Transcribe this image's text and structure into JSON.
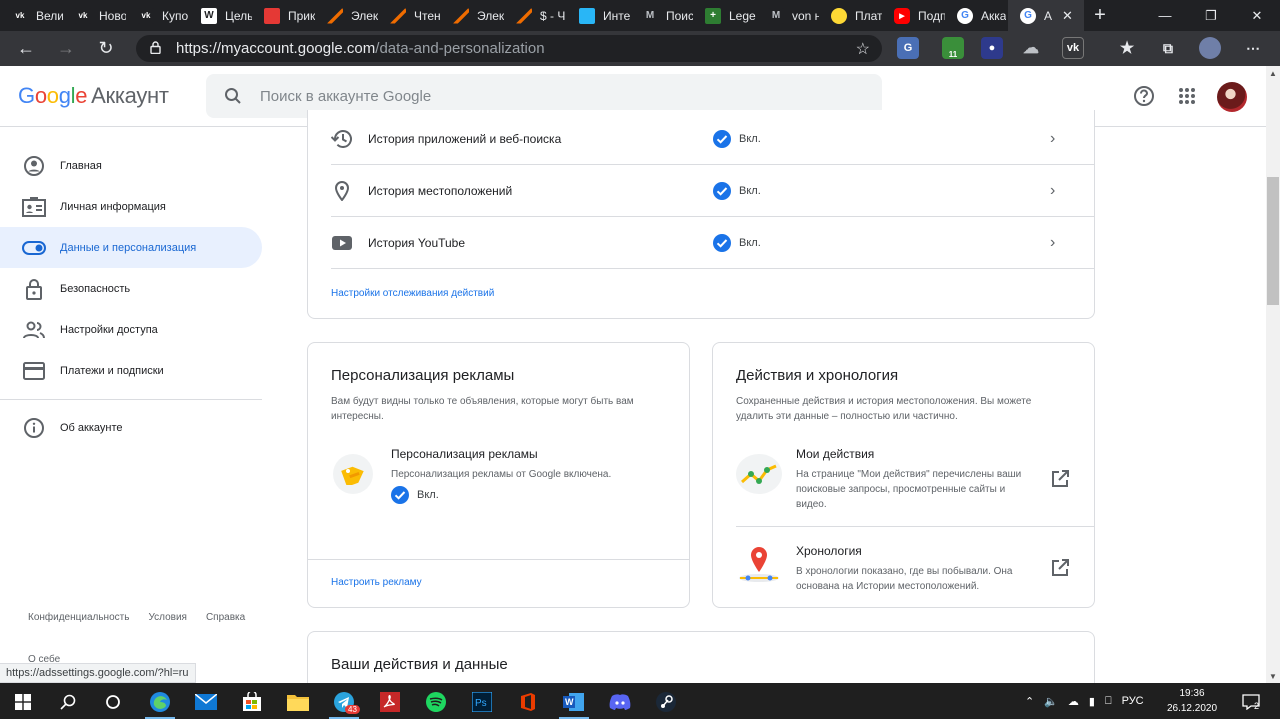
{
  "browser": {
    "tabs": [
      {
        "title": "Вели",
        "favicon": "vk-icon",
        "color": "#202124"
      },
      {
        "title": "Ново",
        "favicon": "vk-icon",
        "color": "#202124"
      },
      {
        "title": "Купо",
        "favicon": "vk-icon",
        "color": "#202124"
      },
      {
        "title": "Цель",
        "favicon": "wiki-icon",
        "color": "#ffffff"
      },
      {
        "title": "Прик",
        "favicon": "video-icon",
        "color": "#e53935"
      },
      {
        "title": "Элек",
        "favicon": "pen-icon",
        "color": "#ef6c00"
      },
      {
        "title": "Чтен",
        "favicon": "pen-icon",
        "color": "#ef6c00"
      },
      {
        "title": "Элек",
        "favicon": "pen-icon",
        "color": "#ef6c00"
      },
      {
        "title": "$ - Ч",
        "favicon": "pen-icon",
        "color": "#ef6c00"
      },
      {
        "title": "Инте",
        "favicon": "square-icon",
        "color": "#29b6f6"
      },
      {
        "title": "Поис",
        "favicon": "m-icon",
        "color": "#202124"
      },
      {
        "title": "Leger",
        "favicon": "plus-icon",
        "color": "#2e7d32"
      },
      {
        "title": "von н",
        "favicon": "m-icon",
        "color": "#202124"
      },
      {
        "title": "Плате",
        "favicon": "coin-icon",
        "color": "#fdd835"
      },
      {
        "title": "Подп",
        "favicon": "youtube-icon",
        "color": "#ff0000"
      },
      {
        "title": "Акка",
        "favicon": "google-icon",
        "color": "#ffffff"
      },
      {
        "title": "А",
        "favicon": "google-icon",
        "color": "#ffffff",
        "active": true
      }
    ],
    "url_host": "https://myaccount.google.com",
    "url_path": "/data-and-personalization",
    "ext_badge": "11",
    "status_url": "https://adssettings.google.com/?hl=ru"
  },
  "header": {
    "logo_text": [
      "G",
      "o",
      "o",
      "g",
      "l",
      "e"
    ],
    "account_word": "Аккаунт",
    "search_placeholder": "Поиск в аккаунте Google"
  },
  "sidebar": {
    "items": [
      {
        "label": "Главная"
      },
      {
        "label": "Личная информация"
      },
      {
        "label": "Данные и персонализация",
        "active": true
      },
      {
        "label": "Безопасность"
      },
      {
        "label": "Настройки доступа"
      },
      {
        "label": "Платежи и подписки"
      }
    ],
    "about_label": "Об аккаунте",
    "footer": {
      "privacy": "Конфиденциальность",
      "terms": "Условия",
      "help": "Справка"
    },
    "partial_text": "О себе"
  },
  "history": {
    "rows": [
      {
        "label": "История приложений и веб-поиска",
        "status": "Вкл."
      },
      {
        "label": "История местоположений",
        "status": "Вкл."
      },
      {
        "label": "История YouTube",
        "status": "Вкл."
      }
    ],
    "link": "Настройки отслеживания действий"
  },
  "ads_card": {
    "title": "Персонализация рекламы",
    "desc": "Вам будут видны только те объявления, которые могут быть вам интересны.",
    "item_title": "Персонализация рекламы",
    "item_desc": "Персонализация рекламы от Google включена.",
    "item_status": "Вкл.",
    "link": "Настроить рекламу"
  },
  "activity_card": {
    "title": "Действия и хронология",
    "desc": "Сохраненные действия и история местоположения. Вы можете удалить эти данные – полностью или частично.",
    "items": [
      {
        "title": "Мои действия",
        "desc": "На странице \"Мои действия\" перечислены ваши поисковые запросы, просмотренные сайты и видео."
      },
      {
        "title": "Хронология",
        "desc": "В хронологии показано, где вы побывали. Она основана на Истории местоположений."
      }
    ]
  },
  "bottom_card": {
    "title": "Ваши действия и данные"
  },
  "taskbar": {
    "lang": "РУС",
    "time": "19:36",
    "date": "26.12.2020",
    "telegram_badge": "43",
    "notif_count": "2"
  },
  "colors": {
    "accent": "#1a73e8",
    "active_bg": "#e8f0fe",
    "check": "#1a73e8"
  }
}
